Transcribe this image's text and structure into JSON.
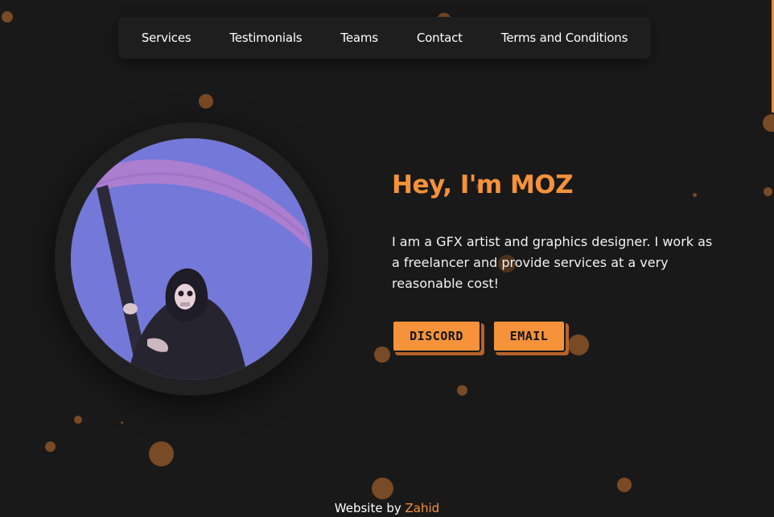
{
  "nav": {
    "items": [
      {
        "label": "Services"
      },
      {
        "label": "Testimonials"
      },
      {
        "label": "Teams"
      },
      {
        "label": "Contact"
      },
      {
        "label": "Terms and Conditions"
      }
    ]
  },
  "hero": {
    "title": "Hey, I'm MOZ",
    "description": "I am a GFX artist and graphics designer. I work as a freelancer and provide services at a very reasonable cost!",
    "avatar_icon": "grim-reaper-avatar",
    "buttons": {
      "discord_label": "DISCORD",
      "email_label": "EMAIL"
    }
  },
  "footer": {
    "prefix": "Website by",
    "author": "Zahid"
  },
  "colors": {
    "background": "#1a1919",
    "accent": "#f5923a",
    "particle": "#8a5428"
  }
}
